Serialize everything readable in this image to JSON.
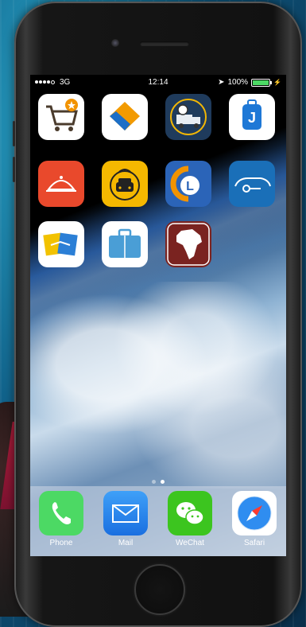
{
  "status_bar": {
    "carrier": "3G",
    "time": "12:14",
    "battery": "100%",
    "battery_level": 1.0
  },
  "apps": [
    {
      "name": "shopping-cart-app-icon",
      "bg": "#ffffff"
    },
    {
      "name": "diamond-orange-app-icon",
      "bg": "#ffffff"
    },
    {
      "name": "delivery-truck-app-icon",
      "bg": "#1f3b5c"
    },
    {
      "name": "luggage-j-app-icon",
      "bg": "#ffffff"
    },
    {
      "name": "food-cloche-app-icon",
      "bg": "#e9492c"
    },
    {
      "name": "taxi-app-icon",
      "bg": "#f5b800"
    },
    {
      "name": "l-logo-app-icon",
      "bg": "#2b64b8"
    },
    {
      "name": "car-key-app-icon",
      "bg": "#1a6fb8"
    },
    {
      "name": "handshake-cards-app-icon",
      "bg": "#ffffff"
    },
    {
      "name": "briefcase-app-icon",
      "bg": "#ffffff"
    },
    {
      "name": "africa-map-app-icon",
      "bg": "#7a2320"
    }
  ],
  "page_indicator": {
    "count": 2,
    "active": 1
  },
  "dock": {
    "phone": "Phone",
    "mail": "Mail",
    "wechat": "WeChat",
    "safari": "Safari"
  }
}
